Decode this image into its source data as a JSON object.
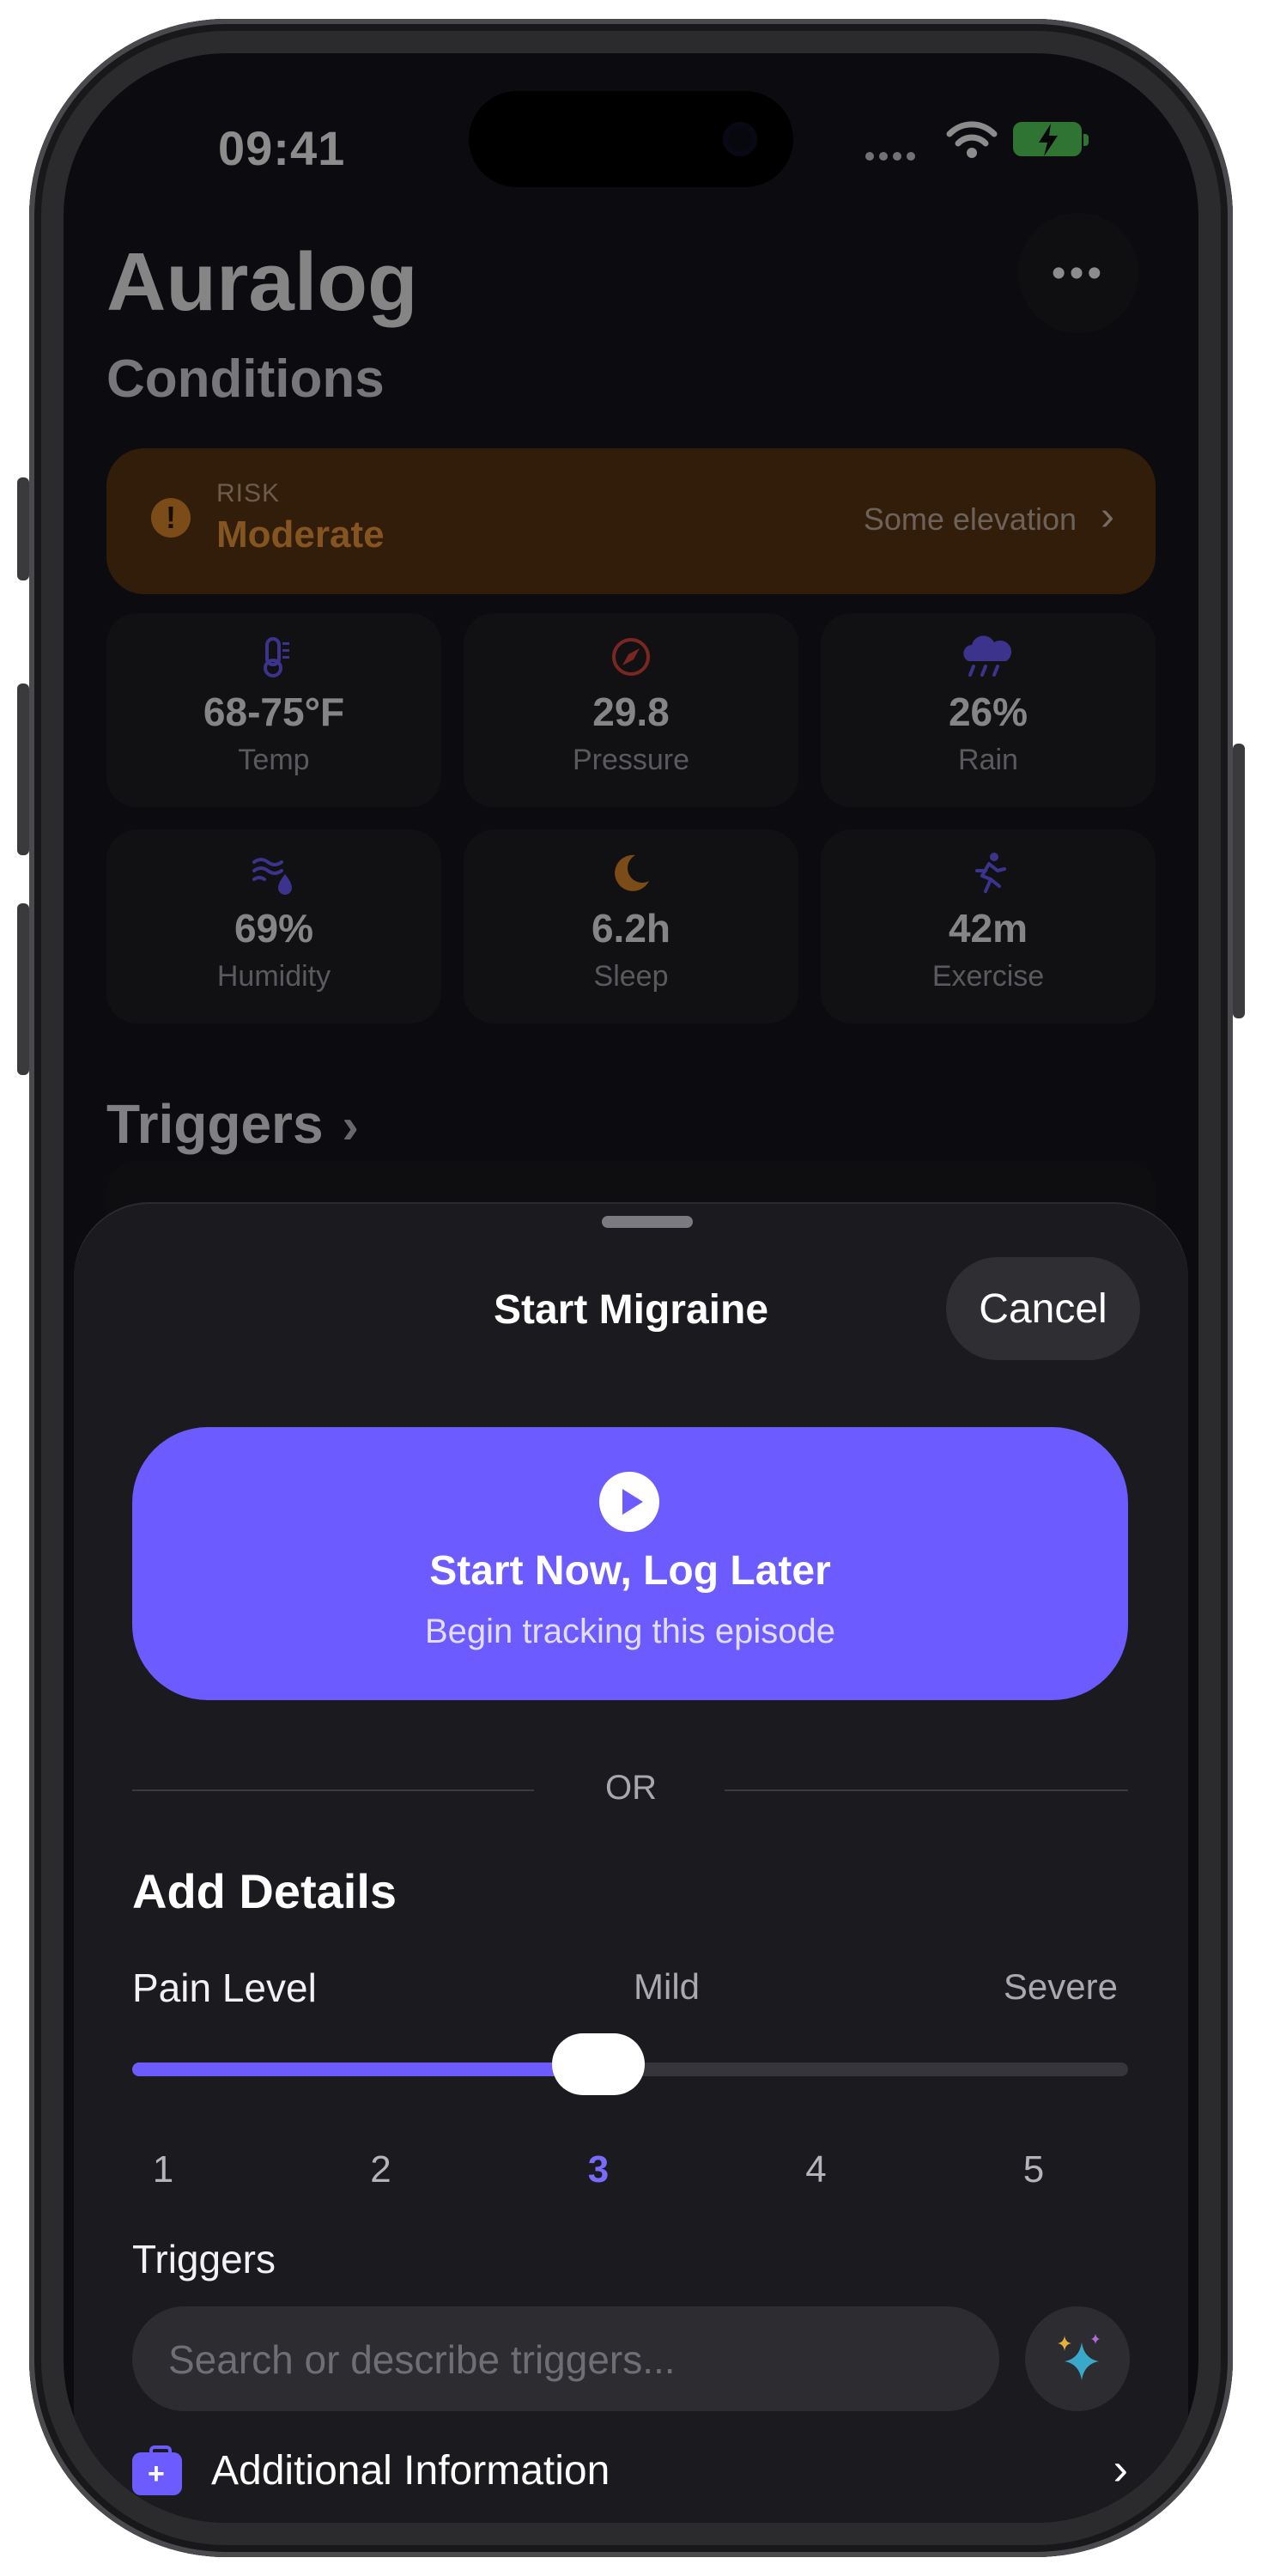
{
  "status_bar": {
    "time": "09:41"
  },
  "header": {
    "app_title": "Auralog",
    "subtitle": "Conditions",
    "more_label": "•••"
  },
  "risk": {
    "label": "RISK",
    "value": "Moderate",
    "note": "Some elevation",
    "color": "#f09a3a"
  },
  "conditions": [
    {
      "value": "68-75°F",
      "label": "Temp",
      "icon": "thermometer-icon",
      "color": "#6c5cff"
    },
    {
      "value": "29.8",
      "label": "Pressure",
      "icon": "compass-icon",
      "color": "#e0463a"
    },
    {
      "value": "26%",
      "label": "Rain",
      "icon": "cloud-rain-icon",
      "color": "#6c5cff"
    },
    {
      "value": "69%",
      "label": "Humidity",
      "icon": "humidity-icon",
      "color": "#6c5cff"
    },
    {
      "value": "6.2h",
      "label": "Sleep",
      "icon": "moon-icon",
      "color": "#e08a2a"
    },
    {
      "value": "42m",
      "label": "Exercise",
      "icon": "running-icon",
      "color": "#6c5cff"
    }
  ],
  "triggers_section": {
    "title": "Triggers"
  },
  "sheet": {
    "title": "Start Migraine",
    "cancel_label": "Cancel",
    "start_now": {
      "title": "Start Now, Log Later",
      "subtitle": "Begin tracking this episode"
    },
    "or_label": "OR",
    "add_details_title": "Add Details",
    "pain": {
      "label": "Pain Level",
      "mild_label": "Mild",
      "severe_label": "Severe",
      "value": 3,
      "ticks": [
        "1",
        "2",
        "3",
        "4",
        "5"
      ]
    },
    "triggers_label": "Triggers",
    "search_placeholder": "Search or describe triggers...",
    "additional_info_label": "Additional Information"
  },
  "colors": {
    "accent": "#6c5cff",
    "warning": "#f09a3a",
    "sheet_bg": "#1b1b1f"
  }
}
